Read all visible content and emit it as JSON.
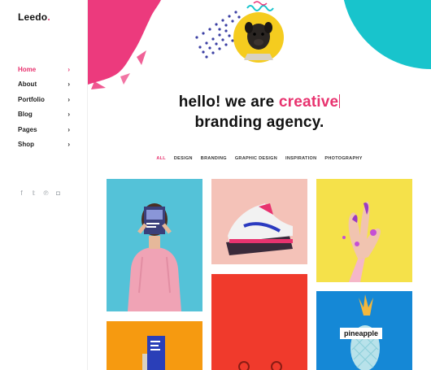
{
  "brand": {
    "name": "Leedo",
    "dot": "."
  },
  "nav": {
    "items": [
      {
        "label": "Home",
        "active": true
      },
      {
        "label": "About"
      },
      {
        "label": "Portfolio"
      },
      {
        "label": "Blog"
      },
      {
        "label": "Pages"
      },
      {
        "label": "Shop"
      }
    ],
    "chevron": "›"
  },
  "social": {
    "icons": [
      "facebook-icon",
      "twitter-icon",
      "pinterest-icon",
      "instagram-icon"
    ],
    "glyphs": [
      "f",
      "𝕥",
      "℗",
      "◘"
    ]
  },
  "hero": {
    "line1_prefix": "hello! we are ",
    "line1_accent": "creative",
    "line2": "branding agency."
  },
  "filters": [
    "ALL",
    "DESIGN",
    "BRANDING",
    "GRAPHIC DESIGN",
    "INSPIRATION",
    "PHOTOGRAPHY"
  ],
  "portfolio": {
    "tag_label": "pineapple"
  },
  "colors": {
    "accent": "#e8336f",
    "teal": "#18c4cc",
    "yellow": "#f5cc1f",
    "sky": "#54c2d8",
    "peach": "#f4c2b8",
    "lemon": "#f5e14a",
    "red": "#f03a2c",
    "orange": "#f69a10",
    "blue": "#1588d6"
  }
}
